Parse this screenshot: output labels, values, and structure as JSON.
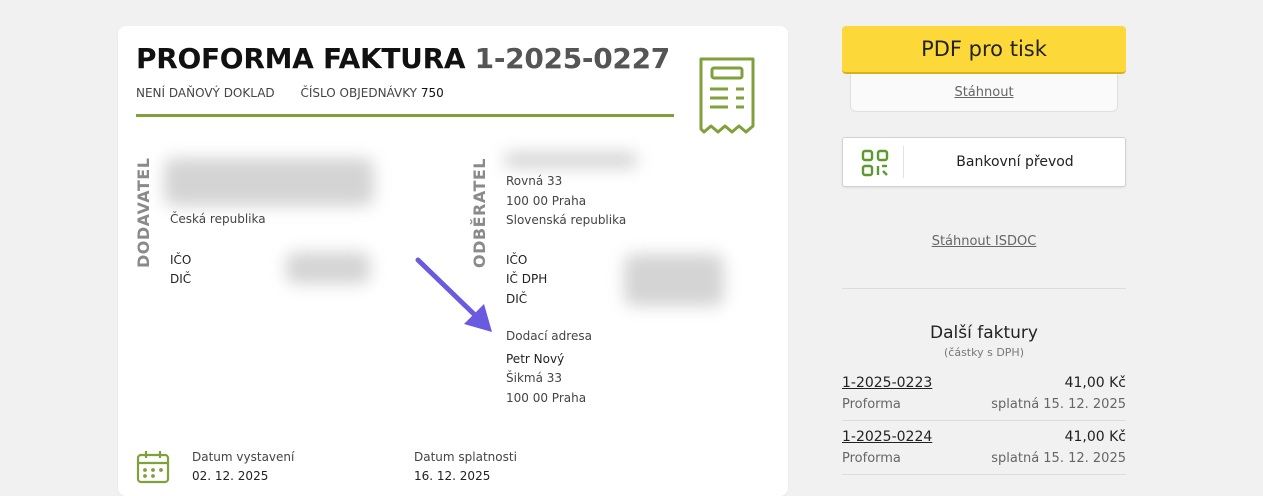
{
  "invoice": {
    "title_prefix": "PROFORMA FAKTURA",
    "number": "1-2025-0227",
    "not_tax_doc": "NENÍ DAŇOVÝ DOKLAD",
    "order_label": "ČÍSLO OBJEDNÁVKY",
    "order_number": "750"
  },
  "supplier": {
    "heading": "DODAVATEL",
    "country": "Česká republika",
    "ico_label": "IČO",
    "dic_label": "DIČ"
  },
  "customer": {
    "heading": "ODBĚRATEL",
    "street": "Rovná 33",
    "city": "100 00 Praha",
    "country": "Slovenská republika",
    "ico_label": "IČO",
    "icdph_label": "IČ DPH",
    "dic_label": "DIČ",
    "delivery_label": "Dodací adresa",
    "delivery_name": "Petr Nový",
    "delivery_street": "Šikmá 33",
    "delivery_city": "100 00 Praha"
  },
  "dates": {
    "issued_label": "Datum vystavení",
    "issued_value": "02. 12. 2025",
    "due_label": "Datum splatnosti",
    "due_value": "16. 12. 2025"
  },
  "actions": {
    "pdf_label": "PDF pro tisk",
    "download_label": "Stáhnout",
    "bank_label": "Bankovní převod",
    "isdoc_label": "Stáhnout ISDOC"
  },
  "other": {
    "title": "Další faktury",
    "subtitle": "(částky s DPH)",
    "items": [
      {
        "id": "1-2025-0223",
        "amount": "41,00 Kč",
        "type": "Proforma",
        "due": "splatná 15. 12. 2025"
      },
      {
        "id": "1-2025-0224",
        "amount": "41,00 Kč",
        "type": "Proforma",
        "due": "splatná 15. 12. 2025"
      }
    ]
  },
  "colors": {
    "accent_green": "#7fa03a",
    "pdf_yellow": "#fcd939",
    "arrow_purple": "#6a5ae0"
  }
}
